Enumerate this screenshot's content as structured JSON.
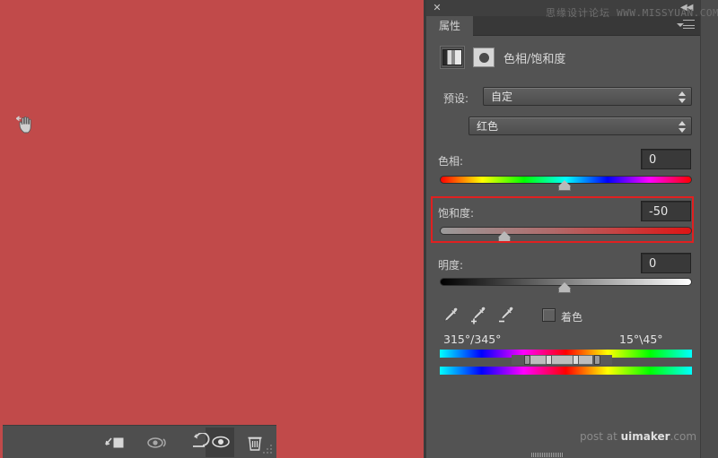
{
  "window": {
    "close_label": "✕",
    "collapse_label": "◀◀",
    "watermark_top_cn": "思缘设计论坛",
    "watermark_top_url": "WWW.MISSYUAN.COM",
    "watermark_bottom_pre": "post at ",
    "watermark_bottom_brand": "uimaker",
    "watermark_bottom_post": ".com"
  },
  "panel": {
    "tab_label": "属性",
    "menu_icon": "panel-menu-icon",
    "adjustment_title": "色相/饱和度",
    "adjustment_icon": "hue-saturation-icon",
    "mask_icon": "layer-mask-icon"
  },
  "preset": {
    "label": "预设:",
    "value": "自定",
    "target_tool_icon": "targeted-adjustment-hand-icon"
  },
  "channel": {
    "value": "红色"
  },
  "sliders": [
    {
      "name": "hue",
      "label": "色相:",
      "value": "0",
      "thumb_percent": 50,
      "track": "rainbow"
    },
    {
      "name": "saturation",
      "label": "饱和度:",
      "value": "-50",
      "thumb_percent": 25,
      "track": "gray-to-red",
      "highlighted": true
    },
    {
      "name": "lightness",
      "label": "明度:",
      "value": "0",
      "thumb_percent": 50,
      "track": "black-to-white"
    }
  ],
  "colorize": {
    "label": "着色",
    "checked": false
  },
  "eyedroppers": [
    {
      "name": "eyedropper-sample",
      "icon": "eyedropper-icon"
    },
    {
      "name": "eyedropper-add",
      "icon": "eyedropper-plus-icon"
    },
    {
      "name": "eyedropper-subtract",
      "icon": "eyedropper-minus-icon"
    }
  ],
  "color_range": {
    "left_label": "315°/345°",
    "right_label": "15°\\45°"
  },
  "footer": {
    "clip_icon": "clip-to-layer-icon",
    "preview_icon": "view-previous-state-icon",
    "reset_icon": "reset-icon",
    "visibility_icon": "toggle-visibility-icon",
    "delete_icon": "delete-adjustment-icon"
  },
  "colors": {
    "canvas": "#c14a4a",
    "panel_bg": "#535353",
    "annotation": "#e02020",
    "text": "#d8d8d8"
  }
}
